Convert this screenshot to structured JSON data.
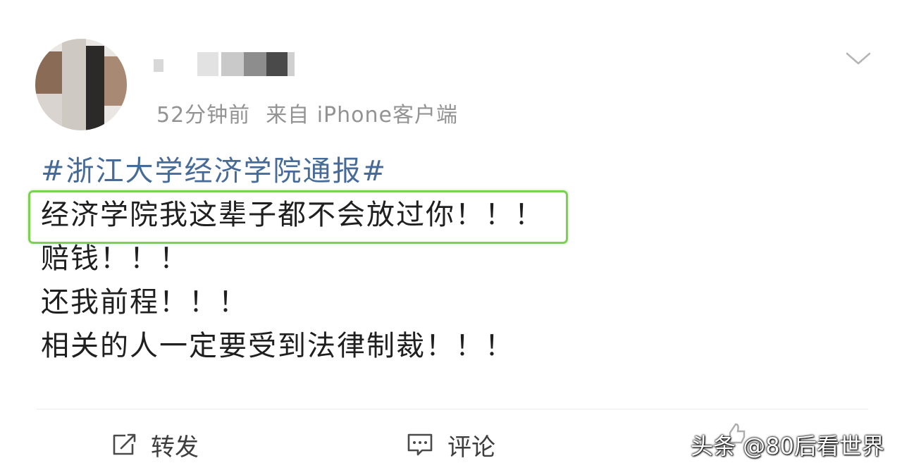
{
  "post": {
    "time": "52分钟前",
    "source": "来自 iPhone客户端",
    "topic": "#浙江大学经济学院通报#",
    "lines": [
      "经济学院我这辈子都不会放过你！！！",
      "赔钱！！！",
      "还我前程！！！",
      "相关的人一定要受到法律制裁！！！"
    ],
    "highlight_color": "#7bd152",
    "topic_color": "#476b98"
  },
  "actions": {
    "repost_label": "转发",
    "repost_icon": "edit-share-icon",
    "comment_label": "评论",
    "comment_icon": "comment-bubble-icon"
  },
  "watermark": "头条 @80后看世界"
}
